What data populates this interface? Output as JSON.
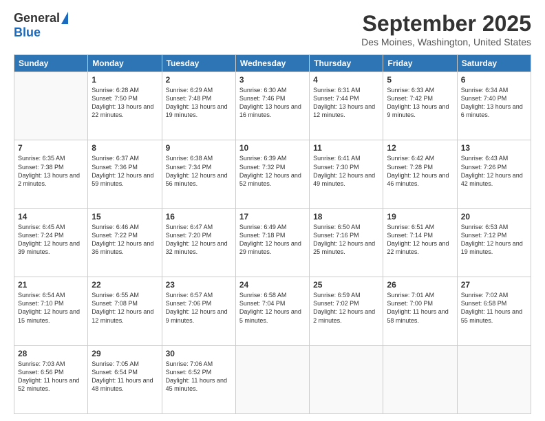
{
  "header": {
    "logo_general": "General",
    "logo_blue": "Blue",
    "month_title": "September 2025",
    "location": "Des Moines, Washington, United States"
  },
  "weekdays": [
    "Sunday",
    "Monday",
    "Tuesday",
    "Wednesday",
    "Thursday",
    "Friday",
    "Saturday"
  ],
  "weeks": [
    [
      {
        "day": "",
        "sunrise": "",
        "sunset": "",
        "daylight": ""
      },
      {
        "day": "1",
        "sunrise": "Sunrise: 6:28 AM",
        "sunset": "Sunset: 7:50 PM",
        "daylight": "Daylight: 13 hours and 22 minutes."
      },
      {
        "day": "2",
        "sunrise": "Sunrise: 6:29 AM",
        "sunset": "Sunset: 7:48 PM",
        "daylight": "Daylight: 13 hours and 19 minutes."
      },
      {
        "day": "3",
        "sunrise": "Sunrise: 6:30 AM",
        "sunset": "Sunset: 7:46 PM",
        "daylight": "Daylight: 13 hours and 16 minutes."
      },
      {
        "day": "4",
        "sunrise": "Sunrise: 6:31 AM",
        "sunset": "Sunset: 7:44 PM",
        "daylight": "Daylight: 13 hours and 12 minutes."
      },
      {
        "day": "5",
        "sunrise": "Sunrise: 6:33 AM",
        "sunset": "Sunset: 7:42 PM",
        "daylight": "Daylight: 13 hours and 9 minutes."
      },
      {
        "day": "6",
        "sunrise": "Sunrise: 6:34 AM",
        "sunset": "Sunset: 7:40 PM",
        "daylight": "Daylight: 13 hours and 6 minutes."
      }
    ],
    [
      {
        "day": "7",
        "sunrise": "Sunrise: 6:35 AM",
        "sunset": "Sunset: 7:38 PM",
        "daylight": "Daylight: 13 hours and 2 minutes."
      },
      {
        "day": "8",
        "sunrise": "Sunrise: 6:37 AM",
        "sunset": "Sunset: 7:36 PM",
        "daylight": "Daylight: 12 hours and 59 minutes."
      },
      {
        "day": "9",
        "sunrise": "Sunrise: 6:38 AM",
        "sunset": "Sunset: 7:34 PM",
        "daylight": "Daylight: 12 hours and 56 minutes."
      },
      {
        "day": "10",
        "sunrise": "Sunrise: 6:39 AM",
        "sunset": "Sunset: 7:32 PM",
        "daylight": "Daylight: 12 hours and 52 minutes."
      },
      {
        "day": "11",
        "sunrise": "Sunrise: 6:41 AM",
        "sunset": "Sunset: 7:30 PM",
        "daylight": "Daylight: 12 hours and 49 minutes."
      },
      {
        "day": "12",
        "sunrise": "Sunrise: 6:42 AM",
        "sunset": "Sunset: 7:28 PM",
        "daylight": "Daylight: 12 hours and 46 minutes."
      },
      {
        "day": "13",
        "sunrise": "Sunrise: 6:43 AM",
        "sunset": "Sunset: 7:26 PM",
        "daylight": "Daylight: 12 hours and 42 minutes."
      }
    ],
    [
      {
        "day": "14",
        "sunrise": "Sunrise: 6:45 AM",
        "sunset": "Sunset: 7:24 PM",
        "daylight": "Daylight: 12 hours and 39 minutes."
      },
      {
        "day": "15",
        "sunrise": "Sunrise: 6:46 AM",
        "sunset": "Sunset: 7:22 PM",
        "daylight": "Daylight: 12 hours and 36 minutes."
      },
      {
        "day": "16",
        "sunrise": "Sunrise: 6:47 AM",
        "sunset": "Sunset: 7:20 PM",
        "daylight": "Daylight: 12 hours and 32 minutes."
      },
      {
        "day": "17",
        "sunrise": "Sunrise: 6:49 AM",
        "sunset": "Sunset: 7:18 PM",
        "daylight": "Daylight: 12 hours and 29 minutes."
      },
      {
        "day": "18",
        "sunrise": "Sunrise: 6:50 AM",
        "sunset": "Sunset: 7:16 PM",
        "daylight": "Daylight: 12 hours and 25 minutes."
      },
      {
        "day": "19",
        "sunrise": "Sunrise: 6:51 AM",
        "sunset": "Sunset: 7:14 PM",
        "daylight": "Daylight: 12 hours and 22 minutes."
      },
      {
        "day": "20",
        "sunrise": "Sunrise: 6:53 AM",
        "sunset": "Sunset: 7:12 PM",
        "daylight": "Daylight: 12 hours and 19 minutes."
      }
    ],
    [
      {
        "day": "21",
        "sunrise": "Sunrise: 6:54 AM",
        "sunset": "Sunset: 7:10 PM",
        "daylight": "Daylight: 12 hours and 15 minutes."
      },
      {
        "day": "22",
        "sunrise": "Sunrise: 6:55 AM",
        "sunset": "Sunset: 7:08 PM",
        "daylight": "Daylight: 12 hours and 12 minutes."
      },
      {
        "day": "23",
        "sunrise": "Sunrise: 6:57 AM",
        "sunset": "Sunset: 7:06 PM",
        "daylight": "Daylight: 12 hours and 9 minutes."
      },
      {
        "day": "24",
        "sunrise": "Sunrise: 6:58 AM",
        "sunset": "Sunset: 7:04 PM",
        "daylight": "Daylight: 12 hours and 5 minutes."
      },
      {
        "day": "25",
        "sunrise": "Sunrise: 6:59 AM",
        "sunset": "Sunset: 7:02 PM",
        "daylight": "Daylight: 12 hours and 2 minutes."
      },
      {
        "day": "26",
        "sunrise": "Sunrise: 7:01 AM",
        "sunset": "Sunset: 7:00 PM",
        "daylight": "Daylight: 11 hours and 58 minutes."
      },
      {
        "day": "27",
        "sunrise": "Sunrise: 7:02 AM",
        "sunset": "Sunset: 6:58 PM",
        "daylight": "Daylight: 11 hours and 55 minutes."
      }
    ],
    [
      {
        "day": "28",
        "sunrise": "Sunrise: 7:03 AM",
        "sunset": "Sunset: 6:56 PM",
        "daylight": "Daylight: 11 hours and 52 minutes."
      },
      {
        "day": "29",
        "sunrise": "Sunrise: 7:05 AM",
        "sunset": "Sunset: 6:54 PM",
        "daylight": "Daylight: 11 hours and 48 minutes."
      },
      {
        "day": "30",
        "sunrise": "Sunrise: 7:06 AM",
        "sunset": "Sunset: 6:52 PM",
        "daylight": "Daylight: 11 hours and 45 minutes."
      },
      {
        "day": "",
        "sunrise": "",
        "sunset": "",
        "daylight": ""
      },
      {
        "day": "",
        "sunrise": "",
        "sunset": "",
        "daylight": ""
      },
      {
        "day": "",
        "sunrise": "",
        "sunset": "",
        "daylight": ""
      },
      {
        "day": "",
        "sunrise": "",
        "sunset": "",
        "daylight": ""
      }
    ]
  ]
}
